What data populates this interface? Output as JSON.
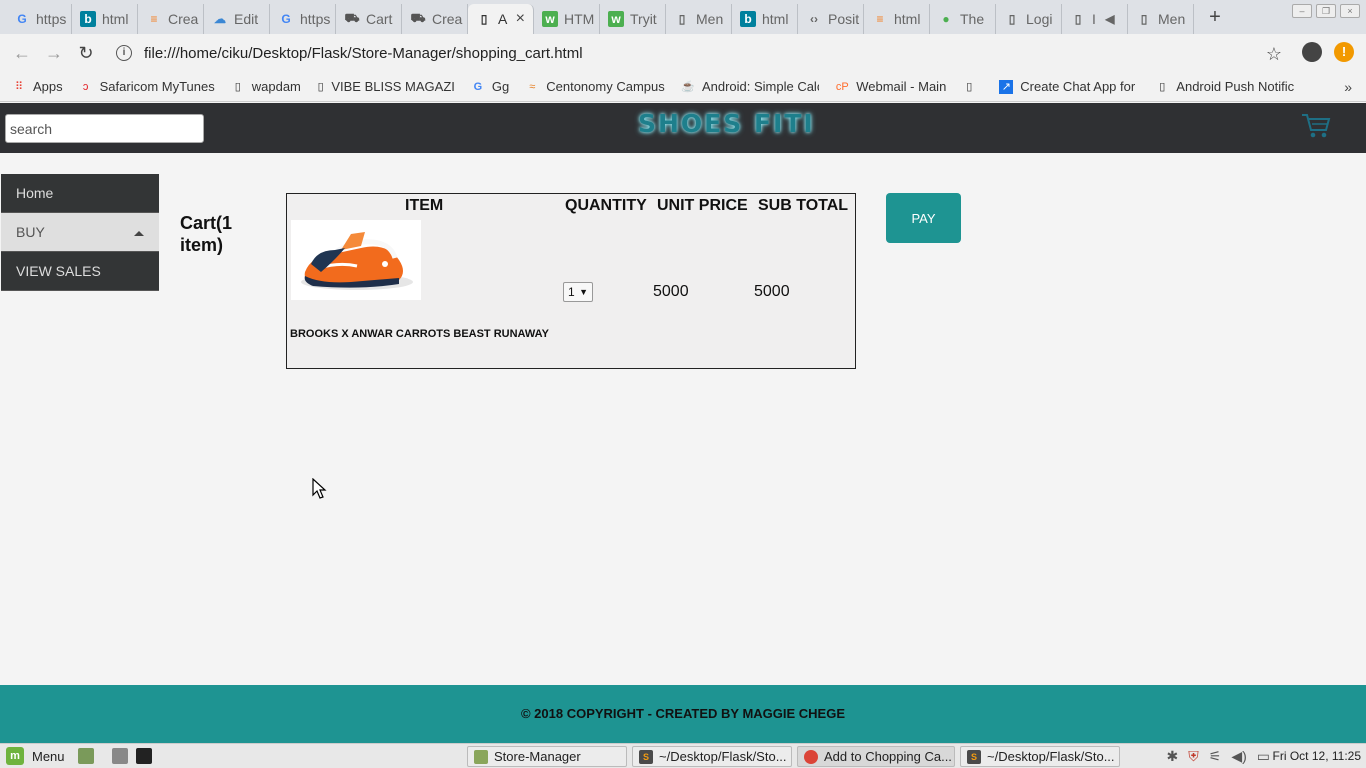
{
  "browser": {
    "tabs": [
      {
        "label": "https",
        "icon": "google-icon"
      },
      {
        "label": "html",
        "icon": "bing-icon"
      },
      {
        "label": "Crea",
        "icon": "stackoverflow-icon"
      },
      {
        "label": "Edit",
        "icon": "cloud-icon"
      },
      {
        "label": "https",
        "icon": "google-icon"
      },
      {
        "label": "Cart",
        "icon": "cart-icon"
      },
      {
        "label": "Crea",
        "icon": "cart-icon"
      },
      {
        "label": "A",
        "icon": "page-icon",
        "active": true
      },
      {
        "label": "HTM",
        "icon": "w3schools-icon"
      },
      {
        "label": "Tryit",
        "icon": "w3schools-icon"
      },
      {
        "label": "Men",
        "icon": "page-icon"
      },
      {
        "label": "html",
        "icon": "bing-icon"
      },
      {
        "label": "Posit",
        "icon": "code-icon"
      },
      {
        "label": "html",
        "icon": "stackoverflow-icon"
      },
      {
        "label": "The",
        "icon": "leaf-icon"
      },
      {
        "label": "Logi",
        "icon": "page-icon"
      },
      {
        "label": "I",
        "icon": "page-icon"
      },
      {
        "label": "Men",
        "icon": "page-icon"
      }
    ],
    "url": "file:///home/ciku/Desktop/Flask/Store-Manager/shopping_cart.html",
    "bookmarks": [
      {
        "label": "Apps",
        "icon": "apps-grid-icon"
      },
      {
        "label": "Safaricom MyTunes",
        "icon": "safaricom-icon"
      },
      {
        "label": "wapdam",
        "icon": "page-icon"
      },
      {
        "label": "VIBE BLISS MAGAZI",
        "icon": "page-icon"
      },
      {
        "label": "Gg",
        "icon": "google-icon"
      },
      {
        "label": "Centonomy Campus",
        "icon": "centonomy-icon"
      },
      {
        "label": "Android: Simple Calc",
        "icon": "java-icon"
      },
      {
        "label": "Webmail - Main",
        "icon": "cpanel-icon"
      },
      {
        "label": "",
        "icon": "page-icon"
      },
      {
        "label": "Create Chat App for",
        "icon": "pusher-icon"
      },
      {
        "label": "Android Push Notific",
        "icon": "page-icon"
      }
    ],
    "overflow": "»"
  },
  "site": {
    "search_placeholder": "search",
    "logo": "SHOES FITI",
    "menu": [
      {
        "label": "Home"
      },
      {
        "label": "BUY"
      },
      {
        "label": "VIEW SALES"
      }
    ],
    "cart_title": "Cart(1 item)",
    "table": {
      "headers": {
        "item": "ITEM",
        "quantity": "QUANTITY",
        "unit_price": "UNIT PRICE",
        "sub_total": "SUB TOTAL"
      },
      "row": {
        "product_name": "BROOKS X ANWAR CARROTS BEAST RUNAWAY",
        "quantity": "1",
        "unit_price": "5000",
        "sub_total": "5000"
      }
    },
    "pay_label": "PAY",
    "footer": "© 2018 COPYRIGHT - CREATED BY MAGGIE CHEGE"
  },
  "taskbar": {
    "menu_label": "Menu",
    "tasks": [
      {
        "label": "Store-Manager",
        "icon": "folder-icon"
      },
      {
        "label": "~/Desktop/Flask/Sto...",
        "icon": "sublime-icon"
      },
      {
        "label": "Add to Chopping Ca...",
        "icon": "chrome-icon",
        "active": true
      },
      {
        "label": "~/Desktop/Flask/Sto...",
        "icon": "sublime-icon"
      }
    ],
    "clock": "Fri Oct 12, 11:25"
  }
}
